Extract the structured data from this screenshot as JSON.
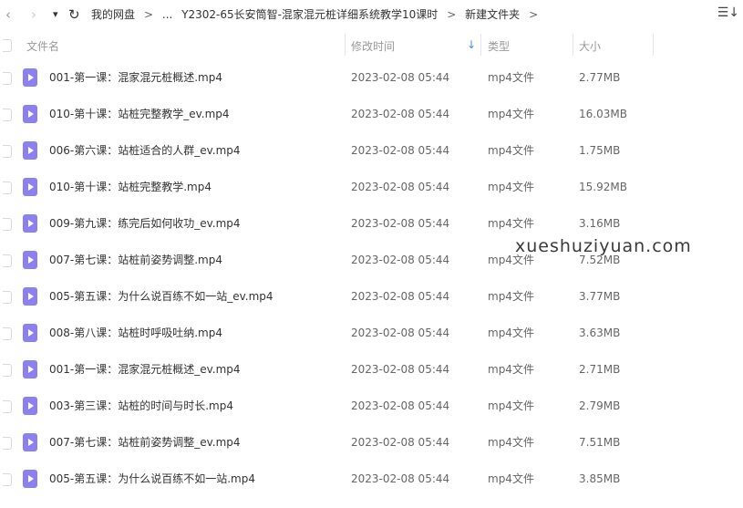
{
  "nav": {
    "back": "‹",
    "forward": "›",
    "dropdown": "▾",
    "refresh": "↻"
  },
  "breadcrumb": [
    "我的网盘",
    "...",
    "Y2302-65长安筒智-混家混元桩详细系统教学10课时",
    "新建文件夹"
  ],
  "breadcrumb_sep": ">",
  "sort_icon": "☰↓",
  "columns": {
    "name": "文件名",
    "time": "修改时间",
    "type": "类型",
    "size": "大小",
    "sort_arrow": "↓"
  },
  "files": [
    {
      "name": "001-第一课：混家混元桩概述.mp4",
      "time": "2023-02-08 05:44",
      "type": "mp4文件",
      "size": "2.77MB"
    },
    {
      "name": "010-第十课：站桩完整教学_ev.mp4",
      "time": "2023-02-08 05:44",
      "type": "mp4文件",
      "size": "16.03MB"
    },
    {
      "name": "006-第六课：站桩适合的人群_ev.mp4",
      "time": "2023-02-08 05:44",
      "type": "mp4文件",
      "size": "1.75MB"
    },
    {
      "name": "010-第十课：站桩完整教学.mp4",
      "time": "2023-02-08 05:44",
      "type": "mp4文件",
      "size": "15.92MB"
    },
    {
      "name": "009-第九课：练完后如何收功_ev.mp4",
      "time": "2023-02-08 05:44",
      "type": "mp4文件",
      "size": "3.16MB"
    },
    {
      "name": "007-第七课：站桩前姿势调整.mp4",
      "time": "2023-02-08 05:44",
      "type": "mp4文件",
      "size": "7.52MB"
    },
    {
      "name": "005-第五课：为什么说百练不如一站_ev.mp4",
      "time": "2023-02-08 05:44",
      "type": "mp4文件",
      "size": "3.77MB"
    },
    {
      "name": "008-第八课：站桩时呼吸吐纳.mp4",
      "time": "2023-02-08 05:44",
      "type": "mp4文件",
      "size": "3.63MB"
    },
    {
      "name": "001-第一课：混家混元桩概述_ev.mp4",
      "time": "2023-02-08 05:44",
      "type": "mp4文件",
      "size": "2.71MB"
    },
    {
      "name": "003-第三课：站桩的时间与时长.mp4",
      "time": "2023-02-08 05:44",
      "type": "mp4文件",
      "size": "2.79MB"
    },
    {
      "name": "007-第七课：站桩前姿势调整_ev.mp4",
      "time": "2023-02-08 05:44",
      "type": "mp4文件",
      "size": "7.51MB"
    },
    {
      "name": "005-第五课：为什么说百练不如一站.mp4",
      "time": "2023-02-08 05:44",
      "type": "mp4文件",
      "size": "3.85MB"
    }
  ],
  "watermark": "xueshuziyuan.com"
}
